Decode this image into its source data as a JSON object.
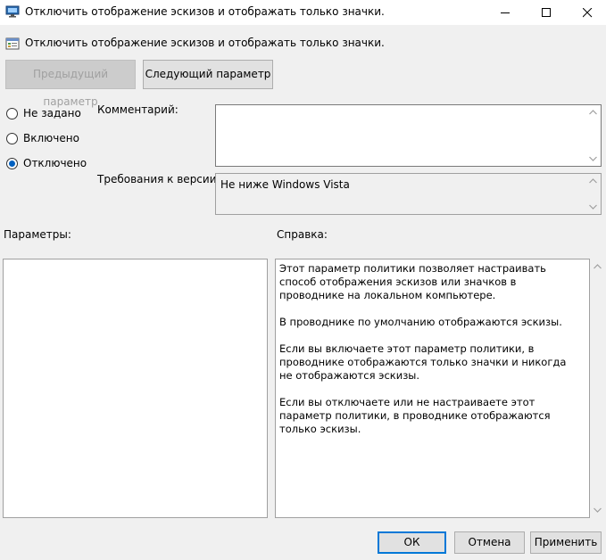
{
  "window": {
    "title": "Отключить отображение эскизов и отображать только значки.",
    "minimize_icon": "minimize-icon",
    "maximize_icon": "maximize-icon",
    "close_icon": "close-icon"
  },
  "header": {
    "title": "Отключить отображение эскизов и отображать только значки.",
    "icon": "policy-setting-icon"
  },
  "nav": {
    "prev_label": "Предыдущий параметр",
    "next_label": "Следующий параметр"
  },
  "state": {
    "options": [
      {
        "label": "Не задано",
        "checked": false
      },
      {
        "label": "Включено",
        "checked": false
      },
      {
        "label": "Отключено",
        "checked": true
      }
    ]
  },
  "comment": {
    "label": "Комментарий:",
    "value": ""
  },
  "requirements": {
    "label": "Требования к версии:",
    "value": "Не ниже Windows Vista"
  },
  "options_panel": {
    "label": "Параметры:"
  },
  "help": {
    "label": "Справка:",
    "paragraphs": [
      "Этот параметр политики позволяет настраивать способ отображения эскизов или значков в проводнике на локальном компьютере.",
      "В проводнике по умолчанию отображаются эскизы.",
      "Если вы включаете этот параметр политики, в проводнике отображаются только значки и никогда не отображаются эскизы.",
      "Если вы отключаете или не настраиваете этот параметр политики, в проводнике отображаются только эскизы."
    ]
  },
  "footer": {
    "ok_label": "ОК",
    "cancel_label": "Отмена",
    "apply_label": "Применить"
  }
}
